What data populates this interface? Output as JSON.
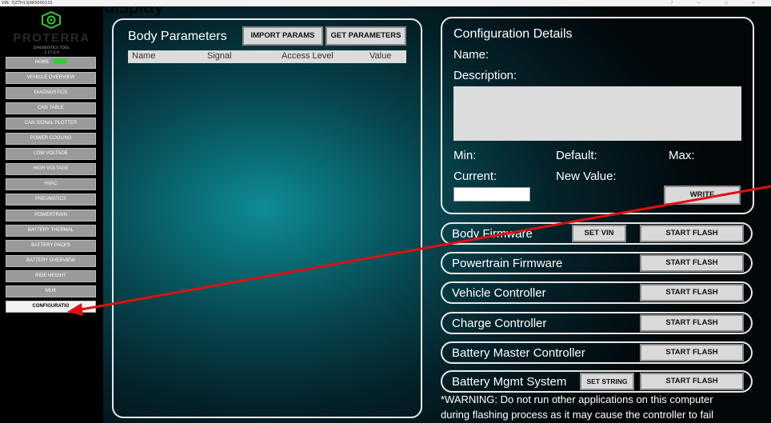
{
  "window": {
    "vin": "VIN: 7JZTH13J9K5000133",
    "controls": "? — ▢ ✕"
  },
  "annotation_partial": "g                       display",
  "brand": {
    "name": "PROTERRA",
    "subtitle": "DIAGNOSTICS TOOL",
    "version": "1.17.0.0",
    "accent": "#35c93a"
  },
  "sidebar": {
    "items": [
      {
        "label": "HOME",
        "has_toggle": true
      },
      {
        "label": "VEHICLE OVERVIEW"
      },
      {
        "label": "DIAGNOSTICS"
      },
      {
        "label": "CAN TABLE"
      },
      {
        "label": "CAN SIGNAL PLOTTER"
      },
      {
        "label": "POWER COOLING"
      },
      {
        "label": "LOW VOLTAGE"
      },
      {
        "label": "HIGH VOLTAGE"
      },
      {
        "label": "HVAC"
      },
      {
        "label": "PNEUMATICS"
      },
      {
        "label": "POWERTRAIN"
      },
      {
        "label": "BATTERY THERMAL"
      },
      {
        "label": "BATTERY PACKS"
      },
      {
        "label": "BATTERY OVERVIEW"
      },
      {
        "label": "RIDE HEIGHT"
      },
      {
        "label": "MUX"
      },
      {
        "label": "CONFIGURATIO",
        "active": true
      }
    ]
  },
  "body_params": {
    "title": "Body Parameters",
    "import_label": "IMPORT PARAMS",
    "get_label": "GET PARAMETERS",
    "columns": {
      "name": "Name",
      "signal": "Signal",
      "access": "Access Level",
      "value": "Value"
    }
  },
  "config": {
    "title": "Configuration Details",
    "name_label": "Name:",
    "desc_label": "Description:",
    "min_label": "Min:",
    "default_label": "Default:",
    "max_label": "Max:",
    "current_label": "Current:",
    "newvalue_label": "New Value:",
    "new_value": "",
    "write_label": "WRITE"
  },
  "flash_rows": [
    {
      "name": "Body Firmware",
      "extra": "SET VIN",
      "flash": "START FLASH"
    },
    {
      "name": "Powertrain Firmware",
      "flash": "START FLASH"
    },
    {
      "name": "Vehicle Controller",
      "flash": "START FLASH"
    },
    {
      "name": "Charge Controller",
      "flash": "START FLASH"
    },
    {
      "name": "Battery Master Controller",
      "flash": "START FLASH"
    },
    {
      "name": "Battery Mgmt System",
      "extra": "SET STRING",
      "flash": "START FLASH"
    }
  ],
  "warning": {
    "line1": "*WARNING: Do not run other applications on this computer",
    "line2": "during flashing process as it may cause the controller to fail"
  },
  "arrow_color": "#e01010"
}
